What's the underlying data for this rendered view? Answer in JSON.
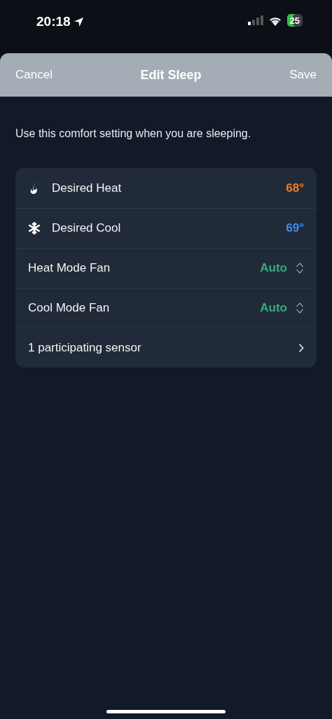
{
  "status_bar": {
    "time": "20:18",
    "battery": "25"
  },
  "nav": {
    "cancel": "Cancel",
    "title": "Edit Sleep",
    "save": "Save"
  },
  "description": "Use this comfort setting when you are sleeping.",
  "settings": [
    {
      "kind": "heat",
      "label": "Desired Heat",
      "value": "68°"
    },
    {
      "kind": "cool",
      "label": "Desired Cool",
      "value": "69°"
    },
    {
      "kind": "picker",
      "label": "Heat Mode Fan",
      "value": "Auto"
    },
    {
      "kind": "picker",
      "label": "Cool Mode Fan",
      "value": "Auto"
    },
    {
      "kind": "link",
      "label": "1 participating sensor"
    }
  ]
}
